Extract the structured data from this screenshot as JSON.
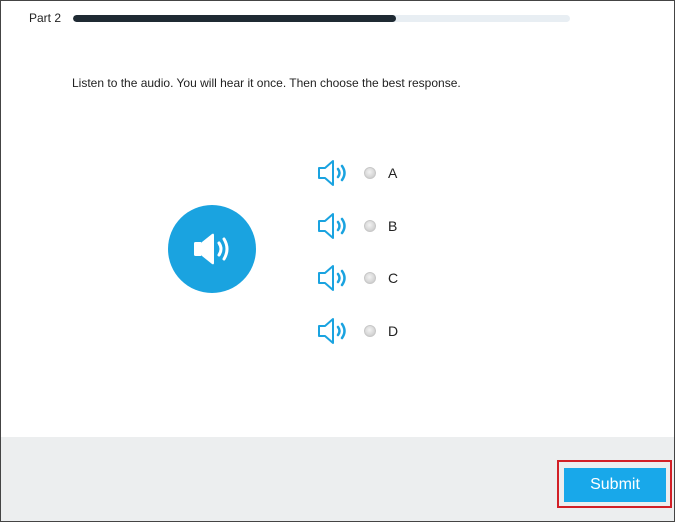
{
  "header": {
    "part_label": "Part 2",
    "progress": 0.65
  },
  "instruction": "Listen to the audio. You will hear it once. Then choose the best response.",
  "options": [
    {
      "letter": "A"
    },
    {
      "letter": "B"
    },
    {
      "letter": "C"
    },
    {
      "letter": "D"
    }
  ],
  "footer": {
    "submit_label": "Submit"
  },
  "colors": {
    "accent": "#1aa3e0",
    "progress_fill": "#1f2a33",
    "highlight_border": "#d21f26"
  },
  "icons": {
    "main_audio": "speaker-icon",
    "option_audio": "speaker-outline-icon",
    "option_select": "radio-button"
  }
}
